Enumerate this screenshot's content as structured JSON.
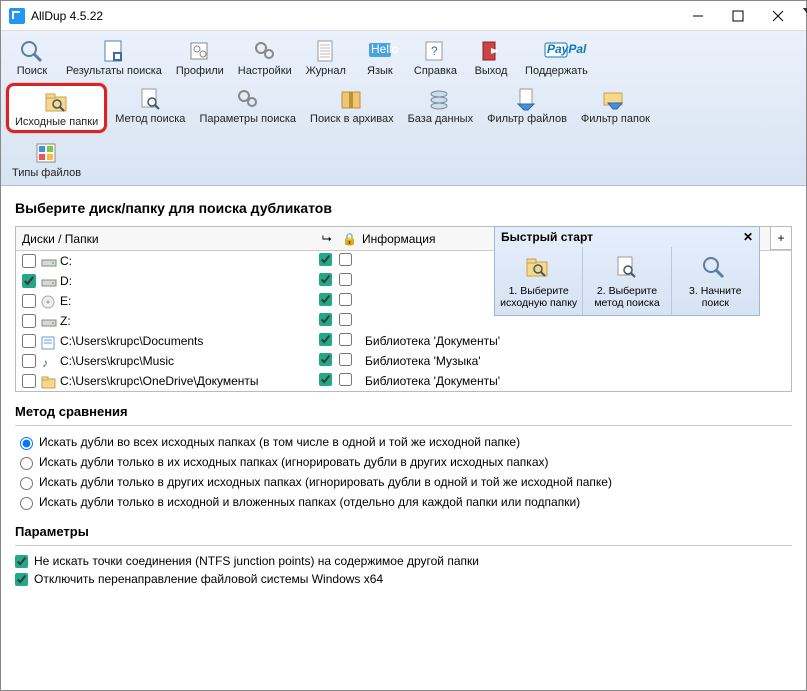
{
  "window": {
    "title": "AllDup 4.5.22"
  },
  "toolbar1": [
    {
      "id": "search",
      "label": "Поиск",
      "icon": "magnifier"
    },
    {
      "id": "results",
      "label": "Результаты поиска",
      "icon": "results"
    },
    {
      "id": "profiles",
      "label": "Профили",
      "icon": "profiles",
      "drop": true
    },
    {
      "id": "settings",
      "label": "Настройки",
      "icon": "gears"
    },
    {
      "id": "journal",
      "label": "Журнал",
      "icon": "journal"
    },
    {
      "id": "language",
      "label": "Язык",
      "icon": "hello",
      "drop": true
    },
    {
      "id": "help",
      "label": "Справка",
      "icon": "help",
      "drop": true
    },
    {
      "id": "exit",
      "label": "Выход",
      "icon": "exit"
    },
    {
      "id": "support",
      "label": "Поддержать",
      "icon": "paypal"
    }
  ],
  "toolbar2": [
    {
      "id": "source-folders",
      "label": "Исходные папки",
      "icon": "folder-mag",
      "drop": true,
      "highlight": true
    },
    {
      "id": "search-method",
      "label": "Метод поиска",
      "icon": "doc-mag",
      "drop": true
    },
    {
      "id": "search-params",
      "label": "Параметры поиска",
      "icon": "gears-sm",
      "drop": true
    },
    {
      "id": "archives",
      "label": "Поиск в архивах",
      "icon": "archive",
      "drop": true
    },
    {
      "id": "database",
      "label": "База данных",
      "icon": "db",
      "drop": true
    },
    {
      "id": "file-filter",
      "label": "Фильтр файлов",
      "icon": "file-filter",
      "drop": true
    },
    {
      "id": "folder-filter",
      "label": "Фильтр папок",
      "icon": "folder-filter",
      "drop": true
    }
  ],
  "toolbar3": [
    {
      "id": "file-types",
      "label": "Типы файлов",
      "icon": "filetypes",
      "drop": true
    }
  ],
  "heading": "Выберите диск/папку для поиска дубликатов",
  "grid": {
    "col1": "Диски / Папки",
    "col4": "Информация",
    "icon_recurse": "↳",
    "icon_lock": "🔒",
    "plus": "+"
  },
  "rows": [
    {
      "chk": false,
      "icon": "drive",
      "path": "C:",
      "r": true,
      "l": false,
      "info": ""
    },
    {
      "chk": true,
      "icon": "drive",
      "path": "D:",
      "r": true,
      "l": false,
      "info": ""
    },
    {
      "chk": false,
      "icon": "disc",
      "path": "E:",
      "r": true,
      "l": false,
      "info": ""
    },
    {
      "chk": false,
      "icon": "drive",
      "path": "Z:",
      "r": true,
      "l": false,
      "info": ""
    },
    {
      "chk": false,
      "icon": "docfolder",
      "path": "C:\\Users\\krupc\\Documents",
      "r": true,
      "l": false,
      "info": "Библиотека 'Документы'"
    },
    {
      "chk": false,
      "icon": "music",
      "path": "C:\\Users\\krupc\\Music",
      "r": true,
      "l": false,
      "info": "Библиотека 'Музыка'"
    },
    {
      "chk": false,
      "icon": "folder",
      "path": "C:\\Users\\krupc\\OneDrive\\Документы",
      "r": true,
      "l": false,
      "info": "Библиотека 'Документы'"
    }
  ],
  "quick": {
    "title": "Быстрый старт",
    "close": "✕",
    "steps": [
      {
        "t1": "1. Выберите",
        "t2": "исходную папку",
        "icon": "folder-mag"
      },
      {
        "t1": "2. Выберите",
        "t2": "метод поиска",
        "icon": "doc-mag"
      },
      {
        "t1": "3. Начните",
        "t2": "поиск",
        "icon": "magnifier"
      }
    ]
  },
  "compare": {
    "heading": "Метод сравнения",
    "opts": [
      "Искать дубли во всех исходных папках (в том числе в одной и той же исходной папке)",
      "Искать дубли только в их исходных папках (игнорировать дубли в других исходных папках)",
      "Искать дубли только в других исходных папках (игнорировать дубли в одной и той же исходной папке)",
      "Искать дубли только в исходной и вложенных папках (отдельно для каждой папки или подпапки)"
    ],
    "selected": 0
  },
  "params": {
    "heading": "Параметры",
    "opts": [
      {
        "label": "Не искать точки соединения (NTFS junction points) на содержимое другой папки",
        "chk": true
      },
      {
        "label": "Отключить перенаправление файловой системы Windows x64",
        "chk": true
      }
    ]
  }
}
